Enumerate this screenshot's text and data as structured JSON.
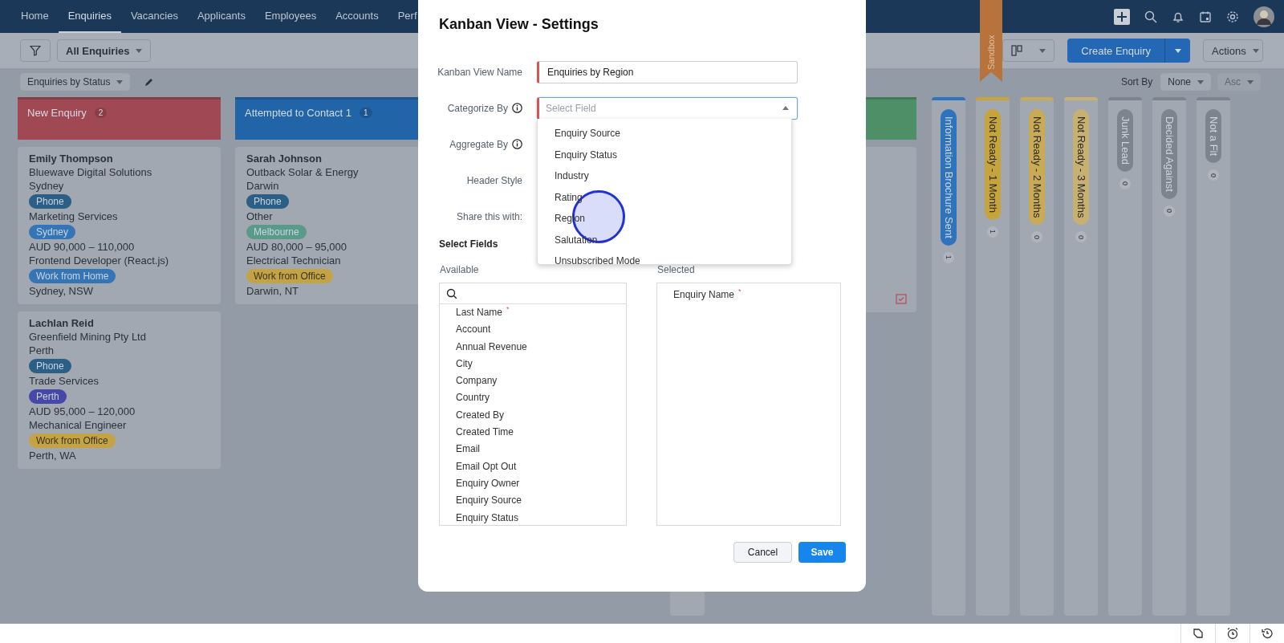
{
  "nav": {
    "tabs": [
      {
        "label": "Home",
        "selected": false
      },
      {
        "label": "Enquiries",
        "selected": true
      },
      {
        "label": "Vacancies",
        "selected": false
      },
      {
        "label": "Applicants",
        "selected": false
      },
      {
        "label": "Employees",
        "selected": false
      },
      {
        "label": "Accounts",
        "selected": false
      },
      {
        "label": "Perf",
        "selected": false
      }
    ]
  },
  "toolbar": {
    "view": "All Enquiries",
    "sandbox": "Sandbox",
    "create": "Create Enquiry",
    "actions": "Actions"
  },
  "subbar": {
    "kanban_view": "Enquiries by Status",
    "sort_label": "Sort By",
    "sort_field": "None",
    "sort_order": {
      "label": "Asc",
      "disabled": true
    }
  },
  "columns": [
    {
      "kind": "expanded",
      "title": "New Enquiry",
      "count": "2",
      "color": "#a04955",
      "cards": [
        {
          "name": "Emily Thompson",
          "lines": [
            {
              "kind": "text",
              "text": "Bluewave Digital Solutions"
            },
            {
              "kind": "text",
              "text": "Sydney"
            },
            {
              "kind": "tag",
              "text": "Phone",
              "color": "#2b5f86"
            },
            {
              "kind": "text",
              "text": "Marketing Services"
            },
            {
              "kind": "tag",
              "text": "Sydney",
              "color": "#3575b6"
            },
            {
              "kind": "text",
              "text": "AUD 90,000 – 110,000"
            },
            {
              "kind": "text",
              "text": "Frontend Developer (React.js)"
            },
            {
              "kind": "tag",
              "text": "Work from Home",
              "color": "#3575b6"
            },
            {
              "kind": "text",
              "text": "Sydney, NSW"
            }
          ]
        },
        {
          "name": "Lachlan Reid",
          "lines": [
            {
              "kind": "text",
              "text": "Greenfield Mining Pty Ltd"
            },
            {
              "kind": "text",
              "text": "Perth"
            },
            {
              "kind": "tag",
              "text": "Phone",
              "color": "#2b5f86"
            },
            {
              "kind": "text",
              "text": "Trade Services"
            },
            {
              "kind": "tag",
              "text": "Perth",
              "color": "#4647a8"
            },
            {
              "kind": "text",
              "text": "AUD 95,000 – 120,000"
            },
            {
              "kind": "text",
              "text": "Mechanical Engineer"
            },
            {
              "kind": "tag",
              "text": "Work from Office",
              "color": "#c4a344"
            },
            {
              "kind": "text",
              "text": "Perth, WA"
            }
          ]
        }
      ]
    },
    {
      "kind": "expanded",
      "title": "Attempted to Contact 1",
      "count": "1",
      "color": "#2164a8",
      "cards": [
        {
          "name": "Sarah Johnson",
          "lines": [
            {
              "kind": "text",
              "text": "Outback Solar & Energy"
            },
            {
              "kind": "text",
              "text": "Darwin"
            },
            {
              "kind": "tag",
              "text": "Phone",
              "color": "#2b5f86"
            },
            {
              "kind": "text",
              "text": "Other"
            },
            {
              "kind": "tag",
              "text": "Melbourne",
              "color": "#5a9a89"
            },
            {
              "kind": "text",
              "text": "AUD 80,000 – 95,000"
            },
            {
              "kind": "text",
              "text": "Electrical Technician"
            },
            {
              "kind": "tag",
              "text": "Work from Office",
              "color": "#c4a344"
            },
            {
              "kind": "text",
              "text": "Darwin, NT"
            }
          ]
        }
      ]
    },
    {
      "kind": "blank"
    },
    {
      "kind": "partial",
      "color": "#4f8f68"
    },
    {
      "kind": "collapsed",
      "title": "Information Brochure Sent",
      "count": "1",
      "color": "#2f73bd"
    },
    {
      "kind": "collapsed",
      "title": "Not Ready - 1 Month",
      "count": "1",
      "color": "#c6a43c"
    },
    {
      "kind": "collapsed",
      "title": "Not Ready - 2 Months",
      "count": "0",
      "color": "#c9ab55"
    },
    {
      "kind": "collapsed",
      "title": "Not Ready - 3 Months",
      "count": "0",
      "color": "#c8b072"
    },
    {
      "kind": "collapsed",
      "title": "Junk Lead",
      "count": "0",
      "color": "#7e848d"
    },
    {
      "kind": "collapsed",
      "title": "Decided Against",
      "count": "0",
      "color": "#7e848d"
    },
    {
      "kind": "collapsed",
      "title": "Not a Fit",
      "count": "0",
      "color": "#7e848d"
    }
  ],
  "modal": {
    "title": "Kanban View - Settings",
    "fields": [
      {
        "label": "Kanban View Name",
        "info": false,
        "kind": "input",
        "value": "Enquiries by Region",
        "required": true
      },
      {
        "label": "Categorize By",
        "info": true,
        "kind": "select",
        "placeholder": "Select Field",
        "required": true
      },
      {
        "label": "Aggregate By",
        "info": true,
        "kind": "hidden"
      },
      {
        "label": "Header Style",
        "info": false,
        "kind": "hidden"
      },
      {
        "label": "Share this with:",
        "info": false,
        "kind": "hidden"
      }
    ],
    "dropdown": [
      "Enquiry Source",
      "Enquiry Status",
      "Industry",
      "Rating",
      "Region",
      "Salutation",
      "Unsubscribed Mode"
    ],
    "select_fields": {
      "title": "Select Fields",
      "available_label": "Available",
      "selected_label": "Selected",
      "available": [
        {
          "label": "Last Name",
          "required_mark": "*"
        },
        {
          "label": "Account"
        },
        {
          "label": "Annual Revenue"
        },
        {
          "label": "City"
        },
        {
          "label": "Company"
        },
        {
          "label": "Country"
        },
        {
          "label": "Created By"
        },
        {
          "label": "Created Time"
        },
        {
          "label": "Email"
        },
        {
          "label": "Email Opt Out"
        },
        {
          "label": "Enquiry Owner"
        },
        {
          "label": "Enquiry Source"
        },
        {
          "label": "Enquiry Status"
        }
      ],
      "selected": [
        {
          "label": "Enquiry Name",
          "required_mark": "*"
        }
      ]
    },
    "buttons": {
      "cancel": "Cancel",
      "save": "Save"
    }
  }
}
